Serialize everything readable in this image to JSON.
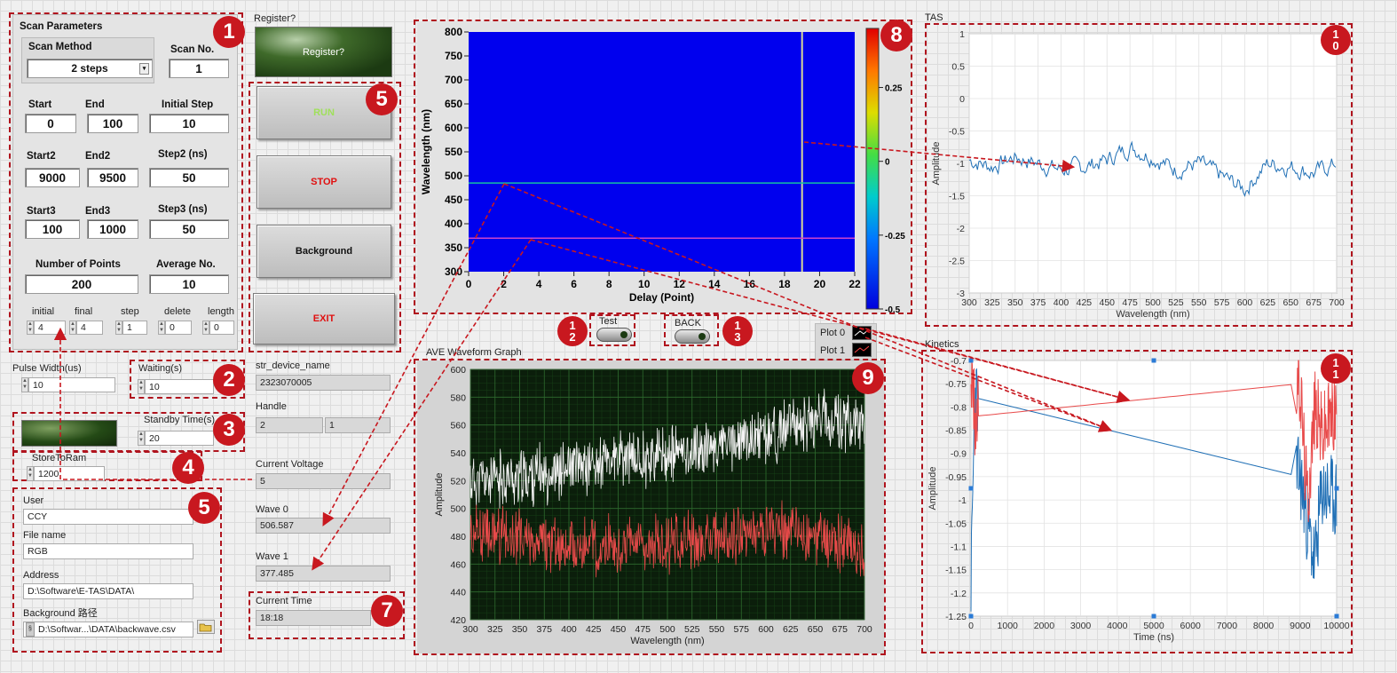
{
  "badges": {
    "b1": "1",
    "b2": "2",
    "b3": "3",
    "b4": "4",
    "b5a": "5",
    "b5b": "5",
    "b7": "7",
    "b8": "8",
    "b9": "9",
    "b10a": "1",
    "b10b": "0",
    "b11a": "1",
    "b11b": "1",
    "b12a": "1",
    "b12b": "2",
    "b13a": "1",
    "b13b": "3"
  },
  "scan": {
    "title": "Scan Parameters",
    "method_label": "Scan Method",
    "method_value": "2 steps",
    "scan_no_label": "Scan No.",
    "scan_no_value": "1",
    "start_label": "Start",
    "start_value": "0",
    "end_label": "End",
    "end_value": "100",
    "initial_step_label": "Initial Step",
    "initial_step_value": "10",
    "start2_label": "Start2",
    "start2_value": "9000",
    "end2_label": "End2",
    "end2_value": "9500",
    "step2_label": "Step2 (ns)",
    "step2_value": "50",
    "start3_label": "Start3",
    "start3_value": "100",
    "end3_label": "End3",
    "end3_value": "1000",
    "step3_label": "Step3 (ns)",
    "step3_value": "50",
    "points_label": "Number of Points",
    "points_value": "200",
    "avg_label": "Average No.",
    "avg_value": "10",
    "initial_label": "initial",
    "initial_value": "4",
    "final_label": "final",
    "final_value": "4",
    "step_label": "step",
    "step_value": "1",
    "delete_label": "delete",
    "delete_value": "0",
    "length_label": "length",
    "length_value": "0"
  },
  "pulse": {
    "label": "Pulse Width(us)",
    "value": "10"
  },
  "waiting": {
    "label": "Waiting(s)",
    "value": "10"
  },
  "standby": {
    "label": "Standby Time(s)",
    "value": "20"
  },
  "store": {
    "label": "StoreToRam",
    "value": "1200"
  },
  "user": {
    "label": "User",
    "value": "CCY"
  },
  "filename": {
    "label": "File name",
    "value": "RGB"
  },
  "address": {
    "label": "Address",
    "value": "D:\\Software\\E-TAS\\DATA\\"
  },
  "background_path": {
    "label": "Background 路径",
    "value": "D:\\Softwar...\\DATA\\backwave.csv"
  },
  "register": {
    "label": "Register?",
    "button": "Register?"
  },
  "buttons": {
    "run": "RUN",
    "stop": "STOP",
    "background": "Background",
    "exit": "EXIT"
  },
  "device": {
    "label": "str_device_name",
    "value": "2323070005"
  },
  "handle": {
    "label": "Handle",
    "value1": "2",
    "value2": "1"
  },
  "voltage": {
    "label": "Current Voltage",
    "value": "5"
  },
  "wave0": {
    "label": "Wave 0",
    "value": "506.587"
  },
  "wave1": {
    "label": "Wave 1",
    "value": "377.485"
  },
  "time": {
    "label": "Current Time",
    "value": "18:18"
  },
  "test": {
    "label": "Test"
  },
  "back": {
    "label": "BACK"
  },
  "legend": {
    "plot0": "Plot 0",
    "plot1": "Plot 1"
  },
  "colors": {
    "annotation": "#c8181f",
    "plot0": "#1f6fb5",
    "plot1": "#e84a4a",
    "heatmap_bg": "#0000ee"
  },
  "chart_data": [
    {
      "type": "heatmap",
      "id": "intensity",
      "title": "",
      "xlabel": "Delay (Point)",
      "ylabel": "Wavelength (nm)",
      "xlim": [
        0,
        22
      ],
      "ylim": [
        300,
        800
      ],
      "xticks": [
        0,
        2,
        4,
        6,
        8,
        10,
        12,
        14,
        16,
        18,
        20,
        22
      ],
      "yticks": [
        300,
        350,
        400,
        450,
        500,
        550,
        600,
        650,
        700,
        750,
        800
      ],
      "cursor_x": 19,
      "cursor_y": [
        485,
        370
      ],
      "colorscale": {
        "min": -0.5,
        "max": 0,
        "ticks": [
          -0.5,
          -0.25,
          0,
          0.25
        ]
      }
    },
    {
      "type": "line",
      "id": "tas",
      "title": "TAS",
      "xlabel": "Wavelength (nm)",
      "ylabel": "Amplitude",
      "xlim": [
        300,
        700
      ],
      "ylim": [
        -3,
        1
      ],
      "xticks": [
        300,
        325,
        350,
        375,
        400,
        425,
        450,
        475,
        500,
        525,
        550,
        575,
        600,
        625,
        650,
        675,
        700
      ],
      "yticks": [
        1,
        0.5,
        0,
        -0.5,
        -1,
        -1.5,
        -2,
        -2.5,
        -3
      ],
      "series": [
        {
          "x": [
            300,
            325,
            350,
            375,
            400,
            425,
            450,
            475,
            500,
            525,
            550,
            575,
            600,
            625,
            650,
            675,
            700
          ],
          "y": [
            -0.95,
            -1.05,
            -0.9,
            -1.0,
            -1.1,
            -1.05,
            -0.95,
            -0.75,
            -0.9,
            -1.1,
            -1.0,
            -1.2,
            -1.4,
            -1.0,
            -1.05,
            -1.15,
            -1.0
          ]
        }
      ]
    },
    {
      "type": "line",
      "id": "ave",
      "title": "AVE Waveform Graph",
      "xlabel": "Wavelength (nm)",
      "ylabel": "Amplitude",
      "xlim": [
        300,
        700
      ],
      "ylim": [
        420,
        600
      ],
      "xticks": [
        300,
        325,
        350,
        375,
        400,
        425,
        450,
        475,
        500,
        525,
        550,
        575,
        600,
        625,
        650,
        675,
        700
      ],
      "yticks": [
        420,
        440,
        460,
        480,
        500,
        520,
        540,
        560,
        580,
        600
      ],
      "series": [
        {
          "color": "white",
          "x": [
            300,
            350,
            400,
            450,
            500,
            550,
            600,
            650,
            700
          ],
          "y": [
            520,
            522,
            528,
            535,
            538,
            545,
            552,
            565,
            560
          ]
        },
        {
          "color": "red",
          "x": [
            300,
            350,
            400,
            450,
            500,
            550,
            600,
            650,
            700
          ],
          "y": [
            485,
            478,
            472,
            473,
            475,
            478,
            485,
            478,
            470
          ]
        }
      ]
    },
    {
      "type": "line",
      "id": "kinetics",
      "title": "Kinetics",
      "xlabel": "Time (ns)",
      "ylabel": "Amplitude",
      "xlim": [
        0,
        10000
      ],
      "ylim": [
        -1.25,
        -0.7
      ],
      "xticks": [
        0,
        1000,
        2000,
        3000,
        4000,
        5000,
        6000,
        7000,
        8000,
        9000,
        10000
      ],
      "yticks": [
        -0.7,
        -0.75,
        -0.8,
        -0.85,
        -0.9,
        -0.95,
        -1,
        -1.05,
        -1.1,
        -1.15,
        -1.2,
        -1.25
      ],
      "series": [
        {
          "name": "Plot 0",
          "x": [
            0,
            100,
            9000,
            9200,
            9400,
            9600,
            10000
          ],
          "y": [
            -1.2,
            -0.78,
            -0.95,
            -1.05,
            -1.14,
            -0.98,
            -1.0
          ]
        },
        {
          "name": "Plot 1",
          "x": [
            0,
            100,
            9000,
            9200,
            9400,
            9600,
            10000
          ],
          "y": [
            -0.72,
            -0.82,
            -0.75,
            -1.0,
            -0.8,
            -0.85,
            -0.8
          ]
        }
      ]
    }
  ]
}
